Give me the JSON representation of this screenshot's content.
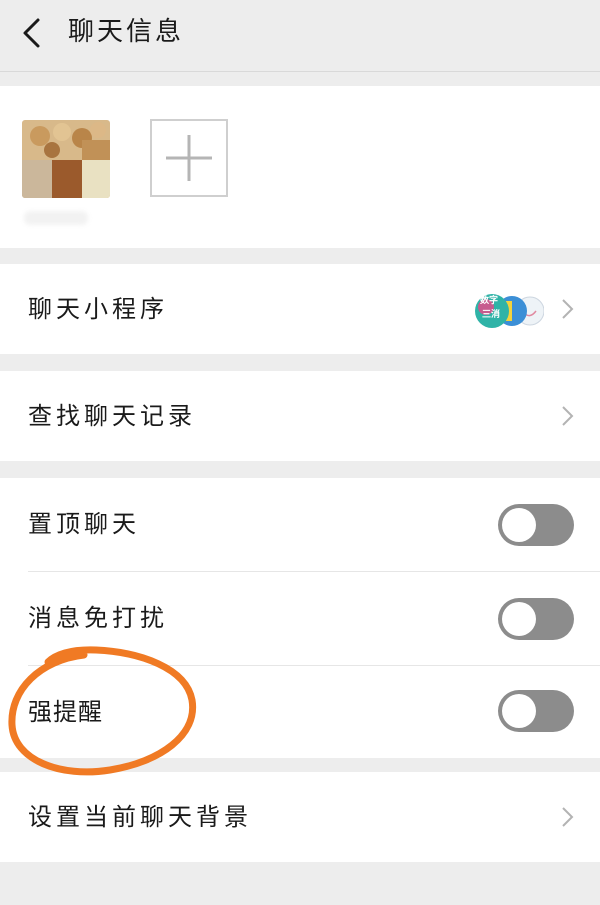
{
  "header": {
    "title": "聊天信息",
    "back_icon": "chevron-left-icon"
  },
  "members": {
    "add_icon": "plus-icon"
  },
  "menu": {
    "mini_programs": {
      "label": "聊天小程序",
      "app_icon_text": [
        "数字",
        "三消"
      ]
    },
    "search_history": {
      "label": "查找聊天记录"
    },
    "settings": [
      {
        "label": "置顶聊天",
        "on": false
      },
      {
        "label": "消息免打扰",
        "on": false
      },
      {
        "label": "强提醒",
        "on": false
      }
    ],
    "background": {
      "label": "设置当前聊天背景"
    }
  },
  "colors": {
    "page_bg": "#ededed",
    "card_bg": "#ffffff",
    "toggle_off": "#8c8c8c",
    "annotation": "#f07a24"
  }
}
